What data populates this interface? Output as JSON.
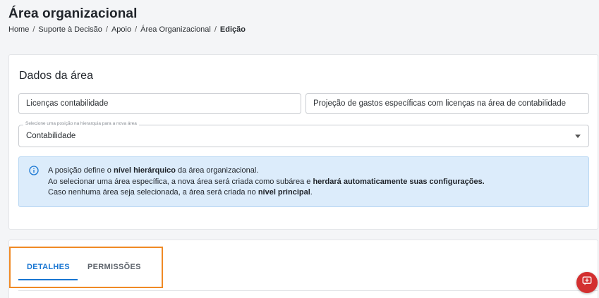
{
  "header": {
    "title": "Área organizacional",
    "breadcrumb": [
      "Home",
      "Suporte à Decisão",
      "Apoio",
      "Área Organizacional"
    ],
    "breadcrumb_current": "Edição",
    "separator": "/"
  },
  "dados": {
    "title": "Dados da área",
    "name_value": "Licenças contabilidade",
    "description_value": "Projeção de gastos específicas com licenças na área de contabilidade",
    "hierarchy": {
      "label": "Selecione uma posição na hierarquia para a nova área",
      "value": "Contabilidade"
    },
    "info": {
      "icon": "info-icon",
      "line1_a": "A posição define o ",
      "line1_b": "nível hierárquico",
      "line1_c": " da área organizacional.",
      "line2_a": "Ao selecionar uma área específica, a nova área será criada como subárea e ",
      "line2_b": "herdará automaticamente suas configurações.",
      "line3_a": "Caso nenhuma área seja selecionada, a área será criada no ",
      "line3_b": "nível principal",
      "line3_c": "."
    }
  },
  "tabs": [
    {
      "label": "DETALHES",
      "active": true
    },
    {
      "label": "PERMISSÕES",
      "active": false
    }
  ],
  "fab": {
    "icon": "chat-icon"
  },
  "colors": {
    "accent": "#1976d2",
    "highlight": "#f08a24",
    "info_bg": "#dcecfb",
    "fab": "#d32f2f"
  }
}
